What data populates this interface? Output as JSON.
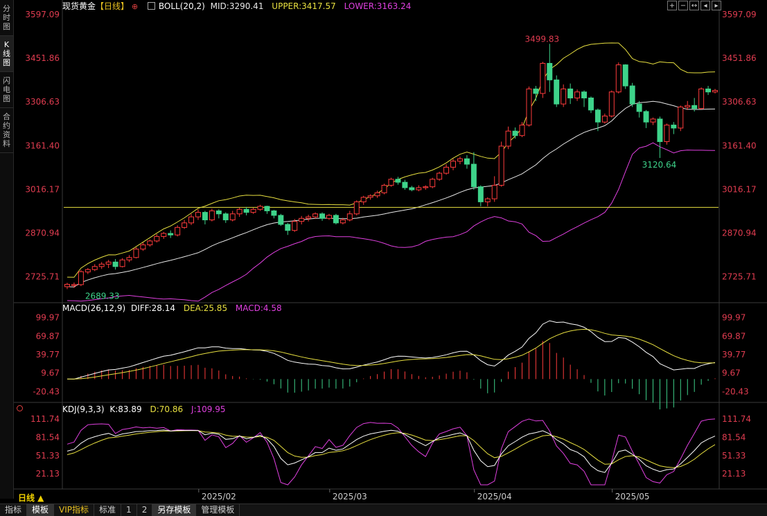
{
  "side_tabs": [
    {
      "label": "分时图",
      "active": false
    },
    {
      "label": "K线图",
      "active": true
    },
    {
      "label": "闪电图",
      "active": false
    },
    {
      "label": "合约资料",
      "active": false
    }
  ],
  "main_header": {
    "symbol": "现货黄金",
    "period_tag": "【日线】",
    "add_icon": "circle-plus-icon",
    "indicator_icon": "indicator-box-icon",
    "boll_label": "BOLL(20,2)",
    "mid_label": "MID:3290.41",
    "upper_label": "UPPER:3417.57",
    "lower_label": "LOWER:3163.24"
  },
  "macd_header": {
    "name": "MACD(26,12,9)",
    "diff": "DIFF:28.14",
    "dea": "DEA:25.85",
    "macd": "MACD:4.58"
  },
  "kdj_header": {
    "name": "KDJ(9,3,3)",
    "k": "K:83.89",
    "d": "D:70.86",
    "j": "J:109.95"
  },
  "toolbar_icons": [
    "zoom-in-icon",
    "zoom-out-icon",
    "fit-icon",
    "left-arrow-icon",
    "right-arrow-icon"
  ],
  "bottom_tabs": [
    {
      "label": "指标",
      "active": false,
      "vip": false
    },
    {
      "label": "模板",
      "active": true,
      "vip": false
    },
    {
      "label": "VIP指标",
      "active": false,
      "vip": true
    },
    {
      "label": "标准",
      "active": false,
      "vip": false
    },
    {
      "label": "1",
      "active": false,
      "vip": false
    },
    {
      "label": "2",
      "active": false,
      "vip": false
    },
    {
      "label": "另存模板",
      "active": true,
      "vip": false
    },
    {
      "label": "管理模板",
      "active": false,
      "vip": false
    }
  ],
  "period_selector": "日线 ▲",
  "colors": {
    "up": "#ff3c3c",
    "down": "#3ed38a",
    "boll_mid": "#e8e8e8",
    "boll_upper": "#e8e040",
    "boll_lower": "#e040e0",
    "axis_text": "#e03c50",
    "k": "#ffffff",
    "d": "#e8e040",
    "j": "#e040e0"
  },
  "chart_data": {
    "type": "candlestick",
    "x_labels": [
      "2025/02",
      "2025/03",
      "2025/04",
      "2025/05"
    ],
    "x_label_index": [
      22,
      41,
      62,
      82
    ],
    "price_axis": {
      "ticks": [
        3597.09,
        3451.86,
        3306.63,
        3161.4,
        3016.17,
        2870.94,
        2725.71
      ],
      "range": [
        2640,
        3597.09
      ]
    },
    "annotations": {
      "max": {
        "value": 3499.83,
        "label": "3499.83",
        "index": 66
      },
      "min": {
        "value": 2689.33,
        "label": "2689.33",
        "index": 1
      },
      "local_min": {
        "value": 3120.64,
        "label": "3120.64",
        "index": 83
      }
    },
    "horizontal_line": 2956.5,
    "candles": [
      [
        2693,
        2701,
        2685,
        2706
      ],
      [
        2697,
        2700,
        2689,
        2707
      ],
      [
        2700,
        2743,
        2695,
        2748
      ],
      [
        2742,
        2750,
        2735,
        2755
      ],
      [
        2750,
        2760,
        2745,
        2768
      ],
      [
        2760,
        2768,
        2752,
        2775
      ],
      [
        2768,
        2775,
        2755,
        2782
      ],
      [
        2775,
        2760,
        2750,
        2785
      ],
      [
        2760,
        2782,
        2757,
        2788
      ],
      [
        2782,
        2790,
        2775,
        2798
      ],
      [
        2790,
        2818,
        2787,
        2824
      ],
      [
        2818,
        2832,
        2812,
        2840
      ],
      [
        2832,
        2845,
        2826,
        2850
      ],
      [
        2845,
        2860,
        2840,
        2868
      ],
      [
        2860,
        2870,
        2852,
        2875
      ],
      [
        2870,
        2865,
        2855,
        2880
      ],
      [
        2865,
        2890,
        2860,
        2897
      ],
      [
        2890,
        2905,
        2885,
        2915
      ],
      [
        2905,
        2925,
        2898,
        2935
      ],
      [
        2925,
        2940,
        2915,
        2950
      ],
      [
        2940,
        2915,
        2900,
        2945
      ],
      [
        2915,
        2945,
        2910,
        2952
      ],
      [
        2945,
        2935,
        2920,
        2950
      ],
      [
        2935,
        2915,
        2905,
        2940
      ],
      [
        2915,
        2935,
        2910,
        2945
      ],
      [
        2935,
        2950,
        2925,
        2955
      ],
      [
        2950,
        2940,
        2930,
        2958
      ],
      [
        2940,
        2950,
        2935,
        2955
      ],
      [
        2950,
        2960,
        2945,
        2965
      ],
      [
        2960,
        2945,
        2935,
        2962
      ],
      [
        2945,
        2930,
        2920,
        2948
      ],
      [
        2930,
        2900,
        2895,
        2935
      ],
      [
        2900,
        2880,
        2865,
        2905
      ],
      [
        2880,
        2910,
        2875,
        2918
      ],
      [
        2910,
        2920,
        2900,
        2928
      ],
      [
        2920,
        2925,
        2910,
        2932
      ],
      [
        2925,
        2935,
        2918,
        2940
      ],
      [
        2935,
        2920,
        2912,
        2940
      ],
      [
        2920,
        2930,
        2915,
        2935
      ],
      [
        2930,
        2905,
        2900,
        2935
      ],
      [
        2905,
        2915,
        2900,
        2922
      ],
      [
        2915,
        2935,
        2910,
        2945
      ],
      [
        2935,
        2975,
        2930,
        2980
      ],
      [
        2975,
        2990,
        2965,
        2995
      ],
      [
        2990,
        2995,
        2982,
        3000
      ],
      [
        2995,
        3005,
        2988,
        3012
      ],
      [
        3005,
        3030,
        3000,
        3035
      ],
      [
        3030,
        3050,
        3025,
        3055
      ],
      [
        3050,
        3040,
        3032,
        3058
      ],
      [
        3040,
        3022,
        3015,
        3048
      ],
      [
        3022,
        3015,
        3010,
        3028
      ],
      [
        3015,
        3022,
        3010,
        3030
      ],
      [
        3022,
        3025,
        3015,
        3030
      ],
      [
        3025,
        3050,
        3020,
        3055
      ],
      [
        3050,
        3070,
        3045,
        3075
      ],
      [
        3070,
        3090,
        3065,
        3100
      ],
      [
        3090,
        3110,
        3080,
        3118
      ],
      [
        3110,
        3118,
        3100,
        3125
      ],
      [
        3118,
        3100,
        3085,
        3130
      ],
      [
        3100,
        3025,
        3015,
        3140
      ],
      [
        3025,
        2975,
        2960,
        3030
      ],
      [
        2975,
        2985,
        2960,
        2990
      ],
      [
        2985,
        3030,
        2975,
        3060
      ],
      [
        3030,
        3160,
        3025,
        3175
      ],
      [
        3160,
        3210,
        3150,
        3225
      ],
      [
        3210,
        3195,
        3185,
        3222
      ],
      [
        3195,
        3230,
        3190,
        3240
      ],
      [
        3230,
        3350,
        3225,
        3358
      ],
      [
        3350,
        3335,
        3310,
        3360
      ],
      [
        3335,
        3435,
        3320,
        3440
      ],
      [
        3435,
        3380,
        3340,
        3499.83
      ],
      [
        3380,
        3300,
        3290,
        3395
      ],
      [
        3300,
        3350,
        3290,
        3365
      ],
      [
        3350,
        3320,
        3300,
        3368
      ],
      [
        3320,
        3340,
        3310,
        3348
      ],
      [
        3340,
        3320,
        3290,
        3345
      ],
      [
        3320,
        3280,
        3270,
        3325
      ],
      [
        3280,
        3240,
        3210,
        3285
      ],
      [
        3240,
        3260,
        3235,
        3268
      ],
      [
        3260,
        3340,
        3255,
        3345
      ],
      [
        3340,
        3430,
        3335,
        3438
      ],
      [
        3430,
        3360,
        3350,
        3432
      ],
      [
        3360,
        3300,
        3290,
        3370
      ],
      [
        3300,
        3275,
        3255,
        3310
      ],
      [
        3275,
        3240,
        3220,
        3280
      ],
      [
        3240,
        3250,
        3230,
        3255
      ],
      [
        3250,
        3175,
        3120.64,
        3258
      ],
      [
        3175,
        3230,
        3165,
        3235
      ],
      [
        3230,
        3220,
        3200,
        3240
      ],
      [
        3220,
        3290,
        3210,
        3295
      ],
      [
        3290,
        3295,
        3280,
        3310
      ],
      [
        3295,
        3285,
        3275,
        3320
      ],
      [
        3285,
        3350,
        3282,
        3355
      ],
      [
        3350,
        3340,
        3330,
        3360
      ],
      [
        3340,
        3345,
        3335,
        3350
      ]
    ],
    "macd_axis": {
      "ticks": [
        99.97,
        69.87,
        39.77,
        9.67,
        -20.43
      ],
      "range": [
        -38,
        112
      ]
    },
    "kdj_axis": {
      "ticks": [
        111.74,
        81.54,
        51.33,
        21.13
      ],
      "range": [
        3,
        120
      ]
    }
  }
}
